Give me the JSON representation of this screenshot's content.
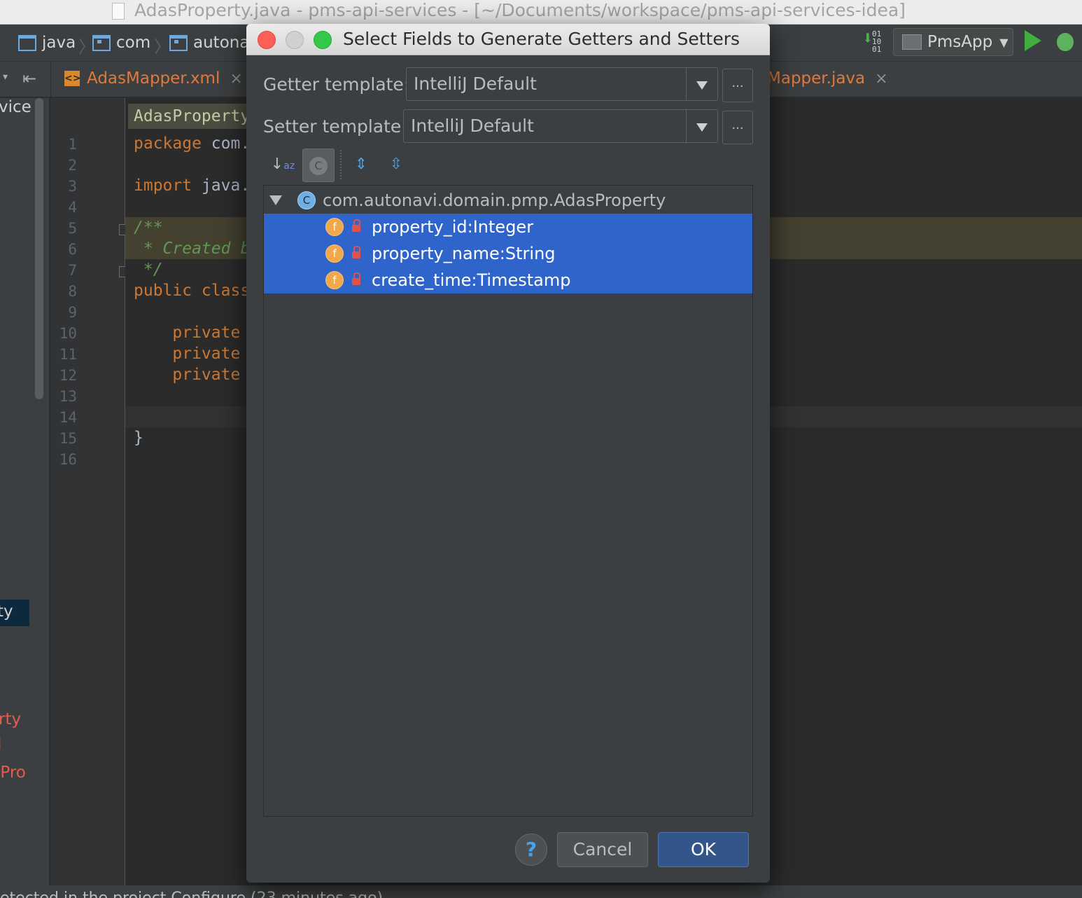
{
  "window": {
    "title": "AdasProperty.java - pms-api-services - [~/Documents/workspace/pms-api-services-idea]"
  },
  "navbar": {
    "breadcrumbs": [
      "java",
      "com",
      "autona"
    ],
    "run_config": "PmsApp",
    "sort_binary_glyph": "01\n10\n01"
  },
  "tabs": {
    "left": {
      "label": "AdasMapper.xml"
    },
    "right": {
      "label": "Mapper.java"
    }
  },
  "project_panel": {
    "header_fragment": "vice",
    "selected_fragment": "ty",
    "items": [
      "rty",
      "l",
      "lPro"
    ]
  },
  "editor": {
    "breadcrumb_hint": "AdasProperty",
    "line_numbers": [
      "1",
      "2",
      "3",
      "4",
      "5",
      "6",
      "7",
      "8",
      "9",
      "10",
      "11",
      "12",
      "13",
      "14",
      "15",
      "16"
    ],
    "lines": {
      "l1_kw": "package",
      "l1_rest": " com.",
      "l3_kw": "import",
      "l3_rest": " java.",
      "l5": "/**",
      "l6": " * Created b",
      "l7": " */",
      "l8": "public class",
      "l10": "    private",
      "l11": "    private",
      "l12": "    private",
      "l15": "}"
    },
    "status_text": "etected in the project Configure (23 minutes ago)"
  },
  "dialog": {
    "title": "Select Fields to Generate Getters and Setters",
    "getter_label": "Getter template:",
    "getter_value": "IntelliJ Default",
    "setter_label": "Setter template:",
    "setter_value": "IntelliJ Default",
    "ellipsis": "...",
    "class_node": {
      "icon_letter": "C",
      "label": "com.autonavi.domain.pmp.AdasProperty"
    },
    "fields": [
      {
        "icon_letter": "f",
        "label": "property_id:Integer",
        "selected": true
      },
      {
        "icon_letter": "f",
        "label": "property_name:String",
        "selected": true
      },
      {
        "icon_letter": "f",
        "label": "create_time:Timestamp",
        "selected": true
      }
    ],
    "help_label": "?",
    "cancel_label": "Cancel",
    "ok_label": "OK"
  }
}
